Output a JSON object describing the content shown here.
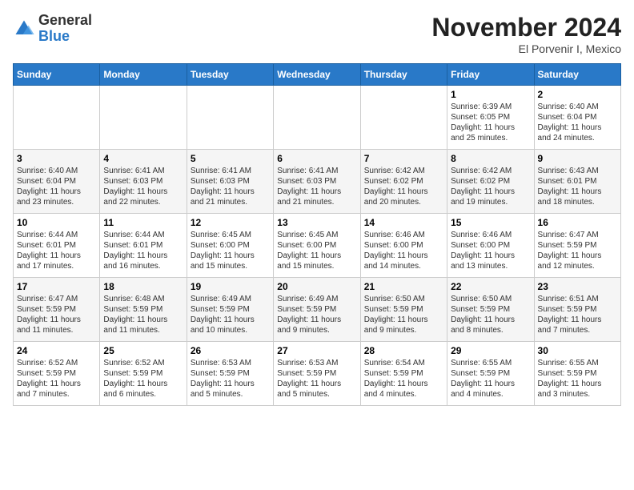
{
  "logo": {
    "general": "General",
    "blue": "Blue"
  },
  "header": {
    "title": "November 2024",
    "subtitle": "El Porvenir I, Mexico"
  },
  "weekdays": [
    "Sunday",
    "Monday",
    "Tuesday",
    "Wednesday",
    "Thursday",
    "Friday",
    "Saturday"
  ],
  "weeks": [
    [
      {
        "day": "",
        "info": ""
      },
      {
        "day": "",
        "info": ""
      },
      {
        "day": "",
        "info": ""
      },
      {
        "day": "",
        "info": ""
      },
      {
        "day": "",
        "info": ""
      },
      {
        "day": "1",
        "info": "Sunrise: 6:39 AM\nSunset: 6:05 PM\nDaylight: 11 hours\nand 25 minutes."
      },
      {
        "day": "2",
        "info": "Sunrise: 6:40 AM\nSunset: 6:04 PM\nDaylight: 11 hours\nand 24 minutes."
      }
    ],
    [
      {
        "day": "3",
        "info": "Sunrise: 6:40 AM\nSunset: 6:04 PM\nDaylight: 11 hours\nand 23 minutes."
      },
      {
        "day": "4",
        "info": "Sunrise: 6:41 AM\nSunset: 6:03 PM\nDaylight: 11 hours\nand 22 minutes."
      },
      {
        "day": "5",
        "info": "Sunrise: 6:41 AM\nSunset: 6:03 PM\nDaylight: 11 hours\nand 21 minutes."
      },
      {
        "day": "6",
        "info": "Sunrise: 6:41 AM\nSunset: 6:03 PM\nDaylight: 11 hours\nand 21 minutes."
      },
      {
        "day": "7",
        "info": "Sunrise: 6:42 AM\nSunset: 6:02 PM\nDaylight: 11 hours\nand 20 minutes."
      },
      {
        "day": "8",
        "info": "Sunrise: 6:42 AM\nSunset: 6:02 PM\nDaylight: 11 hours\nand 19 minutes."
      },
      {
        "day": "9",
        "info": "Sunrise: 6:43 AM\nSunset: 6:01 PM\nDaylight: 11 hours\nand 18 minutes."
      }
    ],
    [
      {
        "day": "10",
        "info": "Sunrise: 6:44 AM\nSunset: 6:01 PM\nDaylight: 11 hours\nand 17 minutes."
      },
      {
        "day": "11",
        "info": "Sunrise: 6:44 AM\nSunset: 6:01 PM\nDaylight: 11 hours\nand 16 minutes."
      },
      {
        "day": "12",
        "info": "Sunrise: 6:45 AM\nSunset: 6:00 PM\nDaylight: 11 hours\nand 15 minutes."
      },
      {
        "day": "13",
        "info": "Sunrise: 6:45 AM\nSunset: 6:00 PM\nDaylight: 11 hours\nand 15 minutes."
      },
      {
        "day": "14",
        "info": "Sunrise: 6:46 AM\nSunset: 6:00 PM\nDaylight: 11 hours\nand 14 minutes."
      },
      {
        "day": "15",
        "info": "Sunrise: 6:46 AM\nSunset: 6:00 PM\nDaylight: 11 hours\nand 13 minutes."
      },
      {
        "day": "16",
        "info": "Sunrise: 6:47 AM\nSunset: 5:59 PM\nDaylight: 11 hours\nand 12 minutes."
      }
    ],
    [
      {
        "day": "17",
        "info": "Sunrise: 6:47 AM\nSunset: 5:59 PM\nDaylight: 11 hours\nand 11 minutes."
      },
      {
        "day": "18",
        "info": "Sunrise: 6:48 AM\nSunset: 5:59 PM\nDaylight: 11 hours\nand 11 minutes."
      },
      {
        "day": "19",
        "info": "Sunrise: 6:49 AM\nSunset: 5:59 PM\nDaylight: 11 hours\nand 10 minutes."
      },
      {
        "day": "20",
        "info": "Sunrise: 6:49 AM\nSunset: 5:59 PM\nDaylight: 11 hours\nand 9 minutes."
      },
      {
        "day": "21",
        "info": "Sunrise: 6:50 AM\nSunset: 5:59 PM\nDaylight: 11 hours\nand 9 minutes."
      },
      {
        "day": "22",
        "info": "Sunrise: 6:50 AM\nSunset: 5:59 PM\nDaylight: 11 hours\nand 8 minutes."
      },
      {
        "day": "23",
        "info": "Sunrise: 6:51 AM\nSunset: 5:59 PM\nDaylight: 11 hours\nand 7 minutes."
      }
    ],
    [
      {
        "day": "24",
        "info": "Sunrise: 6:52 AM\nSunset: 5:59 PM\nDaylight: 11 hours\nand 7 minutes."
      },
      {
        "day": "25",
        "info": "Sunrise: 6:52 AM\nSunset: 5:59 PM\nDaylight: 11 hours\nand 6 minutes."
      },
      {
        "day": "26",
        "info": "Sunrise: 6:53 AM\nSunset: 5:59 PM\nDaylight: 11 hours\nand 5 minutes."
      },
      {
        "day": "27",
        "info": "Sunrise: 6:53 AM\nSunset: 5:59 PM\nDaylight: 11 hours\nand 5 minutes."
      },
      {
        "day": "28",
        "info": "Sunrise: 6:54 AM\nSunset: 5:59 PM\nDaylight: 11 hours\nand 4 minutes."
      },
      {
        "day": "29",
        "info": "Sunrise: 6:55 AM\nSunset: 5:59 PM\nDaylight: 11 hours\nand 4 minutes."
      },
      {
        "day": "30",
        "info": "Sunrise: 6:55 AM\nSunset: 5:59 PM\nDaylight: 11 hours\nand 3 minutes."
      }
    ]
  ]
}
